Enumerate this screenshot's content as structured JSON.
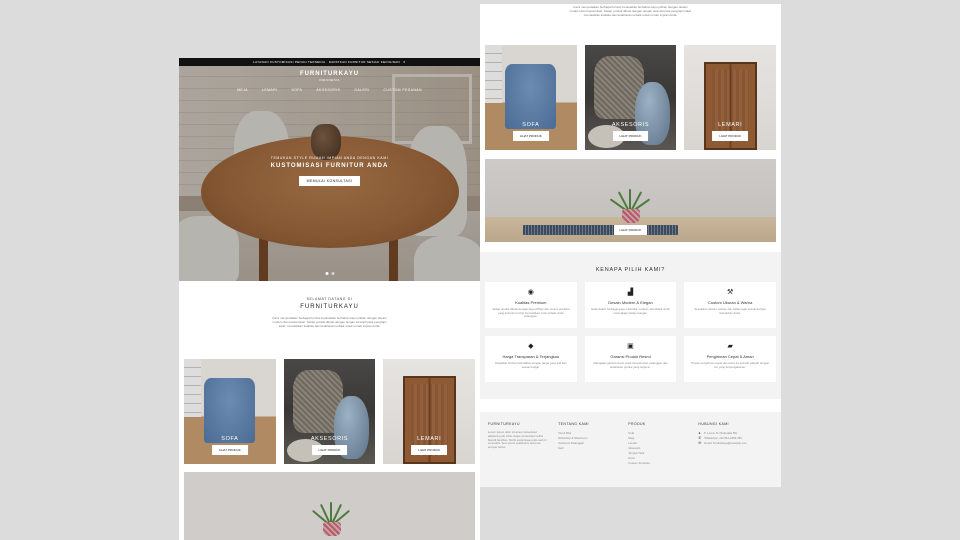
{
  "promo": {
    "text": "LAYANAN KUSTOMISASI PENUH TERSEDIA · DAPATKAN FURNITUR SESUAI KEINGINAN",
    "icon": "close-icon"
  },
  "brand": {
    "name": "FURNITURKAYU",
    "sub": "INDONESIA"
  },
  "nav": [
    "MEJA",
    "LEMARI",
    "SOFA",
    "AKSESORIS",
    "GALERI",
    "CUSTOM PESANAN"
  ],
  "hero": {
    "eyebrow": "TEMUKAN STYLE RUMAH IMPIAN ANDA DENGAN KAMI",
    "headline": "KUSTOMISASI FURNITUR ANDA",
    "cta": "MEMULAI KONSULTASI",
    "slides": 2,
    "active_slide": 0
  },
  "welcome": {
    "eyebrow": "SELAMAT DATANG DI",
    "title": "FURNITURKAYU",
    "desc": "Kami menyediakan berbagai furnitur berkualitas berbahan kayu pilihan dengan desain modern dan kustomisasi. Setiap produk dibuat dengan tangan terampil para pengrajin lokal, memastikan kualitas dan ketahanan terbaik untuk rumah impian Anda."
  },
  "categories": [
    {
      "label": "SOFA",
      "button": "LIHAT PRODUK"
    },
    {
      "label": "AKSESORIS",
      "button": "LIHAT PRODUK"
    },
    {
      "label": "LEMARI",
      "button": "LIHAT PRODUK"
    }
  ],
  "right_top_desc": "Kami menyediakan berbagai furnitur berkualitas berbahan kayu pilihan dengan desain modern dan kustomisasi. Setiap produk dibuat dengan tangan terampil para pengrajin lokal, memastikan kualitas dan ketahanan terbaik untuk rumah impian Anda.",
  "banner": {
    "button": "LIHAT PRODUK"
  },
  "why": {
    "title": "KENAPA PILIH KAMI?",
    "features": [
      {
        "icon": "quality-icon",
        "glyph": "◉",
        "title": "Kualitas Premium",
        "desc": "Setiap produk dibuat dengan kayu pilihan dan proses produksi yang terkontrol untuk memastikan mutu terbaik untuk pelanggan."
      },
      {
        "icon": "design-icon",
        "glyph": "▟",
        "title": "Desain Modern & Elegan",
        "desc": "Hadir dalam berbagai gaya minimalis, modern, dan klasik untuk melengkapi setiap ruangan."
      },
      {
        "icon": "custom-icon",
        "glyph": "⚒",
        "title": "Custom Ukuran & Warna",
        "desc": "Sesuaikan ukuran, warna, dan bahan agar sesuai dengan kebutuhan Anda."
      },
      {
        "icon": "price-tag-icon",
        "glyph": "◆",
        "title": "Harga Transparan & Terjangkau",
        "desc": "Dapatkan furnitur berkualitas dengan harga yang adil dan sesuai budget."
      },
      {
        "icon": "warranty-icon",
        "glyph": "▣",
        "title": "Garansi Produk Resmi",
        "desc": "Dilengkapi garansi resmi untuk kenyamanan pelanggan dan ketahanan produk yang terjamin."
      },
      {
        "icon": "truck-icon",
        "glyph": "▰",
        "title": "Pengiriman Cepat & Aman",
        "desc": "Proses pengiriman cepat dan aman ke seluruh wilayah dengan tim yang berpengalaman."
      }
    ]
  },
  "footer": {
    "about": {
      "title": "FURNITURKAYU",
      "text": "Lorem ipsum dolor sit amet consectetur adipiscing elit. Duis neque consectetur tellus blandit faucibus. Morbi scelerisque justo sed mi venenatis. Sem purus vestibulum sed eros semper luctus."
    },
    "links": {
      "title": "TENTANG KAMI",
      "items": [
        "Visi & Misi",
        "Workshop & Showroom",
        "Testimoni Pelanggan",
        "Karir"
      ]
    },
    "products": {
      "title": "PRODUK",
      "items": [
        "Sofa",
        "Meja",
        "Lemari",
        "Aksesoris",
        "Tempat Tidur",
        "Kursi",
        "Custom Furniture"
      ]
    },
    "contact": {
      "title": "HUBUNGI KAMI",
      "items": [
        {
          "icon": "location-icon",
          "glyph": "●",
          "text": "Jl. Lorem 11 (Sukmaka 59)"
        },
        {
          "icon": "phone-icon",
          "glyph": "✆",
          "text": "WhatsApp: +62 812-3456-789"
        },
        {
          "icon": "mail-icon",
          "glyph": "✉",
          "text": "Email: furniturkayu@example.com"
        }
      ]
    }
  }
}
